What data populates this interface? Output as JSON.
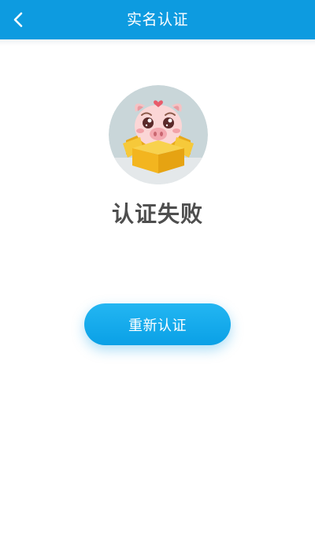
{
  "header": {
    "title": "实名认证",
    "back_icon": "chevron-left-icon",
    "background_color": "#0d9be0"
  },
  "result": {
    "illustration": "sad-pig-in-box-illustration",
    "status_text": "认证失败"
  },
  "actions": {
    "retry_label": "重新认证",
    "button_color": "#12a8ec"
  }
}
